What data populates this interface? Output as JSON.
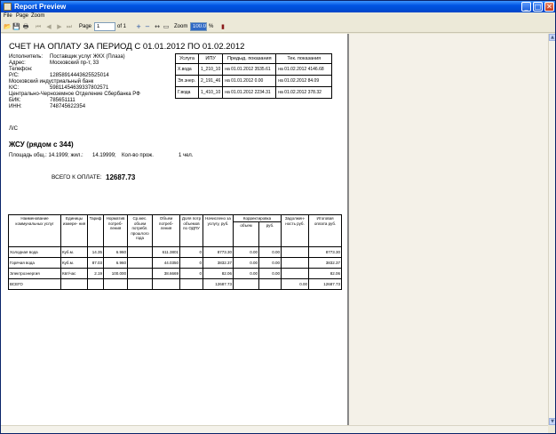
{
  "window": {
    "title": "Report Preview",
    "minimize_glyph": "_",
    "maximize_glyph": "□",
    "close_glyph": "✕"
  },
  "menu": [
    "File",
    "Page",
    "Zoom"
  ],
  "toolbar": {
    "page_label": "Page",
    "page_value": "1",
    "of_label": "of 1",
    "zoom_label": "Zoom",
    "zoom_value": "100.0",
    "percent": "%"
  },
  "icons": {
    "open": "📂",
    "save": "💾",
    "print": "🖶",
    "first": "⏮",
    "prev": "◀",
    "next": "▶",
    "last": "⏭",
    "zoom_in": "+",
    "zoom_out": "−",
    "fit_width": "↔",
    "fit_page": "▭",
    "close_book": "▮",
    "scroll_up": "▲",
    "scroll_down": "▼"
  },
  "document": {
    "title": "СЧЕТ НА ОПЛАТУ ЗА ПЕРИОД С 01.01.2012 ПО 01.02.2012",
    "executor_label": "Исполнитель:",
    "executor_value": "Поставщик услуг ЖКХ (Плаза)",
    "address_label": "Адрес:",
    "address_value": "Московский пр-т, 33",
    "phone_label": "Телефон:",
    "rs_label": "Р/С:",
    "rs_value": "12858914443625525014",
    "bank_name": "Московский индустриальный банк",
    "ks_label": "К/С:",
    "ks_value": "59811454639337802571",
    "branch": "Центрально-Черноземное Отделение Сбербанка РФ",
    "bik_label": "БИК:",
    "bik_value": "785651111",
    "inn_label": "ИНН:",
    "inn_value": "748745622354",
    "ls_label": "Л/С",
    "object_name": "ЖСУ (рядом с 344)",
    "area_text": "Площадь общ.: 14.1999; жил.:",
    "area_living": "14.19999;",
    "residents_label": "Кол-во прож.",
    "residents_value": "1 чел.",
    "total_label": "ВСЕГО К ОПЛАТЕ:",
    "total_value": "12687.73"
  },
  "meters": {
    "headers": [
      "Услуга",
      "ИПУ",
      "Предыд. показания",
      "Тек. показания"
    ],
    "rows": [
      [
        "Х.вода",
        "1_210_10",
        "на 01.01.2012 3535.61",
        "на 01.02.2012 4146.68"
      ],
      [
        "Эл.энер.",
        "2_191_46",
        "на 01.01.2012 0.00",
        "на 01.02.2012 84.09"
      ],
      [
        "Г.вода",
        "1_410_10",
        "на 01.01.2012 2234.31",
        "на 01.02.2012 378.32"
      ]
    ]
  },
  "calc": {
    "headers": {
      "service": "Наименование коммунальных услуг",
      "unit": "Единицы измере- ния",
      "tariff": "Тариф",
      "norm": "Норматив потреб- ления",
      "avg": "Ср.мес. объем потребл. прошлого года",
      "volume": "Объем потреб- ления",
      "odpu": "Доля потр объемов по ОДПУ",
      "charged": "Начислено за услугу, руб.",
      "correction": "Корректировка",
      "corr_volume": "объем",
      "corr_rub": "руб.",
      "debt": "Задолжен- ность руб.",
      "total": "Итоговая оплата руб."
    },
    "rows": [
      [
        "Холодная вода",
        "Куб.м.",
        "14.35",
        "6.960",
        "",
        "611.3801",
        "0",
        "8773.30",
        "0.00",
        "0.00",
        "",
        "8773.30"
      ],
      [
        "Горячая вода",
        "Куб.м.",
        "87.03",
        "6.960",
        "",
        "44.0350",
        "0",
        "3832.37",
        "0.00",
        "0.00",
        "",
        "3832.37"
      ],
      [
        "Электроэнергия",
        "Квт/час",
        "2.19",
        "100.000",
        "",
        "38.6669",
        "0",
        "82.06",
        "0.00",
        "0.00",
        "",
        "82.06"
      ],
      [
        "ВСЕГО",
        "",
        "",
        "",
        "",
        "",
        "",
        "12687.73",
        "",
        "",
        "0.00",
        "12687.73"
      ]
    ]
  }
}
